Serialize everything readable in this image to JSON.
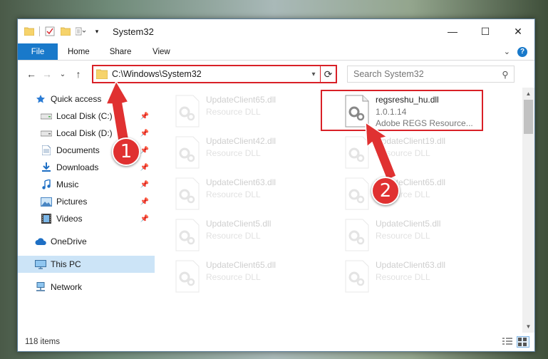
{
  "window": {
    "title": "System32",
    "controls": {
      "minimize": "—",
      "maximize": "☐",
      "close": "✕"
    }
  },
  "ribbon": {
    "tabs": [
      {
        "label": "File"
      },
      {
        "label": "Home"
      },
      {
        "label": "Share"
      },
      {
        "label": "View"
      }
    ],
    "expand": "⌄",
    "help": "?"
  },
  "navigation": {
    "back": "←",
    "forward": "→",
    "recent": "⌄",
    "up": "↑"
  },
  "address": {
    "path": "C:\\Windows\\System32",
    "dropdown": "▾",
    "refresh": "⟳"
  },
  "search": {
    "placeholder": "Search System32",
    "icon": "⚲"
  },
  "sidebar": {
    "quick_access": "Quick access",
    "pinned": [
      {
        "label": "Local Disk (C:)",
        "icon": "drive-icon"
      },
      {
        "label": "Local Disk (D:)",
        "icon": "drive-icon"
      },
      {
        "label": "Documents",
        "icon": "documents-icon"
      },
      {
        "label": "Downloads",
        "icon": "downloads-icon"
      },
      {
        "label": "Music",
        "icon": "music-icon"
      },
      {
        "label": "Pictures",
        "icon": "pictures-icon"
      },
      {
        "label": "Videos",
        "icon": "videos-icon"
      }
    ],
    "onedrive": "OneDrive",
    "this_pc": "This PC",
    "network": "Network"
  },
  "files": [
    {
      "name": "UpdateClient65.dll",
      "type": "Resource DLL"
    },
    {
      "name": "regsreshu_hu.dll",
      "version": "1.0.1.14",
      "type": "Adobe REGS Resource...",
      "highlight": true
    },
    {
      "name": "UpdateClient42.dll",
      "type": "Resource DLL"
    },
    {
      "name": "UpdateClient19.dll",
      "type": "Resource DLL"
    },
    {
      "name": "UpdateClient63.dll",
      "type": "Resource DLL"
    },
    {
      "name": "UpdateClient65.dll",
      "type": "Resource DLL"
    },
    {
      "name": "UpdateClient5.dll",
      "type": "Resource DLL"
    },
    {
      "name": "UpdateClient5.dll",
      "type": "Resource DLL"
    },
    {
      "name": "UpdateClient65.dll",
      "type": "Resource DLL"
    },
    {
      "name": "UpdateClient63.dll",
      "type": "Resource DLL"
    }
  ],
  "status": {
    "item_count": "118 items"
  },
  "callouts": [
    {
      "label": "1"
    },
    {
      "label": "2"
    }
  ],
  "colors": {
    "accent": "#1979ca",
    "highlight_red": "#d92027",
    "callout_red": "#e03131",
    "selected_bg": "#cce4f7"
  }
}
